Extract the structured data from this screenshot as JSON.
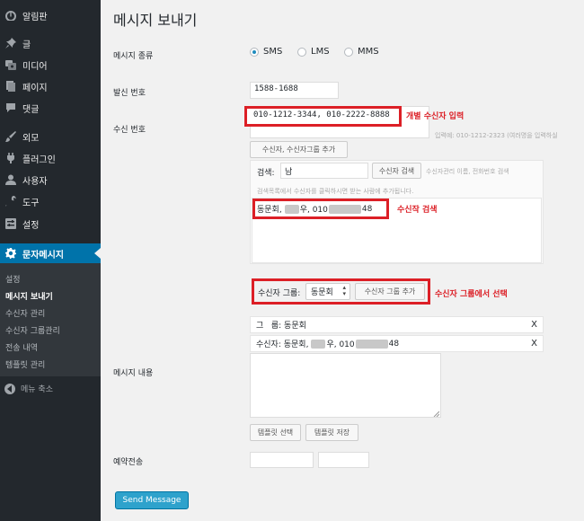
{
  "sidebar": {
    "items": [
      {
        "label": "알림판",
        "icon": "dashboard-icon"
      },
      {
        "label": "글",
        "icon": "pin-icon"
      },
      {
        "label": "미디어",
        "icon": "media-icon"
      },
      {
        "label": "페이지",
        "icon": "page-icon"
      },
      {
        "label": "댓글",
        "icon": "comment-icon"
      },
      {
        "label": "외모",
        "icon": "brush-icon"
      },
      {
        "label": "플러그인",
        "icon": "plugin-icon"
      },
      {
        "label": "사용자",
        "icon": "user-icon"
      },
      {
        "label": "도구",
        "icon": "wrench-icon"
      },
      {
        "label": "설정",
        "icon": "settings-icon"
      }
    ],
    "active": {
      "label": "문자메시지",
      "icon": "gear-icon"
    },
    "submenu": [
      "설정",
      "메시지 보내기",
      "수신자 관리",
      "수신자 그룹관리",
      "전송 내역",
      "템플릿 관리"
    ],
    "collapse_label": "메뉴 축소"
  },
  "main": {
    "title": "메시지 보내기",
    "message_type": {
      "label": "메시지 종류",
      "options": [
        "SMS",
        "LMS",
        "MMS"
      ],
      "selected": "SMS"
    },
    "sender": {
      "label": "발신 번호",
      "value": "1588-1688"
    },
    "recipient": {
      "label": "수신 번호",
      "value": "010-1212-3344, 010-2222-8888",
      "hint": "입력예: 010-1212-2323 (여러명을 입력하실",
      "note": "개별 수신자 입력",
      "add_button": "수신자, 수신자그룹 추가"
    },
    "search": {
      "label": "검색:",
      "value": "남",
      "button": "수신자 검색",
      "hint": "수신자관리 이름, 전화번호 검색",
      "desc": "검색목록에서 수신자를 클릭하시면 받는 사람에 추가됩니다.",
      "result_prefix": "동문회,",
      "result_mid": "우, 010",
      "result_suffix": "48",
      "note": "수신작 검색"
    },
    "group": {
      "label": "수신자 그룹:",
      "selected": "동문회",
      "button": "수신자 그룹 추가",
      "note": "수신자 그룹에서 선택"
    },
    "selected_list": {
      "group_row": "그   룹: 동문회",
      "recipient_prefix": "수신자: 동문회,",
      "recipient_mid": "우, 010",
      "recipient_suffix": "48",
      "remove": "X"
    },
    "content": {
      "label": "메시지 내용",
      "template_select": "템플릿 선택",
      "template_save": "템플릿 저장"
    },
    "schedule": {
      "label": "예약전송"
    },
    "send_button": "Send Message"
  },
  "colors": {
    "sidebar_bg": "#23282d",
    "active": "#0073aa",
    "highlight": "#dc1f26",
    "primary_button": "#2ea2cc"
  }
}
